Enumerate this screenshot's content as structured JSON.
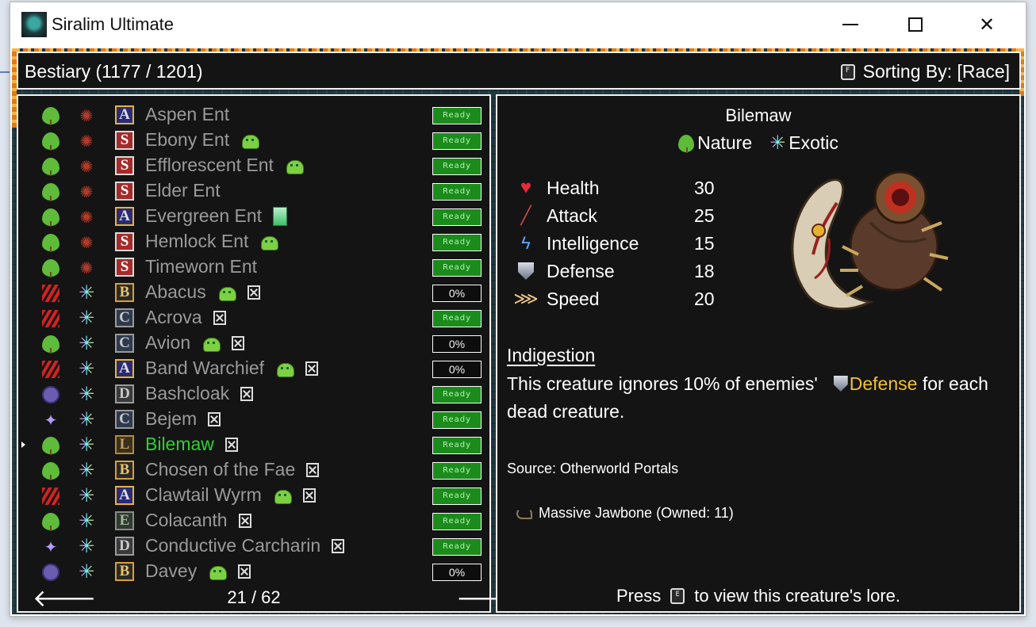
{
  "window": {
    "title": "Siralim Ultimate"
  },
  "header": {
    "title": "Bestiary (1177 / 1201)",
    "sort_key": "F",
    "sort_label": "Sorting By: [Race]"
  },
  "list": {
    "rows": [
      {
        "race": "nature",
        "klass": "spider",
        "rarity": "A",
        "name": "Aspen Ent",
        "extras": [],
        "status": "Ready"
      },
      {
        "race": "nature",
        "klass": "spider",
        "rarity": "S",
        "name": "Ebony Ent",
        "extras": [
          "slime"
        ],
        "status": "Ready"
      },
      {
        "race": "nature",
        "klass": "spider",
        "rarity": "S",
        "name": "Efflorescent Ent",
        "extras": [
          "slime"
        ],
        "status": "Ready"
      },
      {
        "race": "nature",
        "klass": "spider",
        "rarity": "S",
        "name": "Elder Ent",
        "extras": [],
        "status": "Ready"
      },
      {
        "race": "nature",
        "klass": "spider",
        "rarity": "A",
        "name": "Evergreen Ent",
        "extras": [
          "crystal"
        ],
        "status": "Ready"
      },
      {
        "race": "nature",
        "klass": "spider",
        "rarity": "S",
        "name": "Hemlock Ent",
        "extras": [
          "slime"
        ],
        "status": "Ready"
      },
      {
        "race": "nature",
        "klass": "spider",
        "rarity": "S",
        "name": "Timeworn Ent",
        "extras": [],
        "status": "Ready"
      },
      {
        "race": "claw",
        "klass": "exotic",
        "rarity": "B",
        "name": "Abacus",
        "extras": [
          "slime",
          "x"
        ],
        "status": "0%"
      },
      {
        "race": "claw",
        "klass": "exotic",
        "rarity": "C",
        "name": "Acrova",
        "extras": [
          "x"
        ],
        "status": "Ready"
      },
      {
        "race": "nature",
        "klass": "exotic",
        "rarity": "C",
        "name": "Avion",
        "extras": [
          "slime",
          "x"
        ],
        "status": "0%"
      },
      {
        "race": "claw",
        "klass": "exotic",
        "rarity": "A",
        "name": "Band Warchief",
        "extras": [
          "slime",
          "x"
        ],
        "status": "0%"
      },
      {
        "race": "mask",
        "klass": "exotic",
        "rarity": "D",
        "name": "Bashcloak",
        "extras": [
          "x"
        ],
        "status": "Ready"
      },
      {
        "race": "spark",
        "klass": "exotic",
        "rarity": "C",
        "name": "Bejem",
        "extras": [
          "x"
        ],
        "status": "Ready"
      },
      {
        "race": "nature",
        "klass": "exotic",
        "rarity": "L",
        "name": "Bilemaw",
        "extras": [
          "x"
        ],
        "status": "Ready",
        "selected": true
      },
      {
        "race": "nature",
        "klass": "exotic",
        "rarity": "B",
        "name": "Chosen of the Fae",
        "extras": [
          "x"
        ],
        "status": "Ready"
      },
      {
        "race": "claw",
        "klass": "exotic",
        "rarity": "A",
        "name": "Clawtail Wyrm",
        "extras": [
          "slime",
          "x"
        ],
        "status": "Ready"
      },
      {
        "race": "nature",
        "klass": "exotic",
        "rarity": "E",
        "name": "Colacanth",
        "extras": [
          "x"
        ],
        "status": "Ready"
      },
      {
        "race": "spark",
        "klass": "exotic",
        "rarity": "D",
        "name": "Conductive Carcharin",
        "extras": [
          "x"
        ],
        "status": "Ready"
      },
      {
        "race": "mask",
        "klass": "exotic",
        "rarity": "B",
        "name": "Davey",
        "extras": [
          "slime",
          "x"
        ],
        "status": "0%"
      }
    ],
    "page": "21 / 62"
  },
  "detail": {
    "name": "Bilemaw",
    "types": [
      "Nature",
      "Exotic"
    ],
    "stats": [
      {
        "icon": "heart-icon",
        "label": "Health",
        "value": "30"
      },
      {
        "icon": "sword-icon",
        "label": "Attack",
        "value": "25"
      },
      {
        "icon": "lightning-icon",
        "label": "Intelligence",
        "value": "15"
      },
      {
        "icon": "shield-icon",
        "label": "Defense",
        "value": "18"
      },
      {
        "icon": "wing-icon",
        "label": "Speed",
        "value": "20"
      }
    ],
    "ability_title": "Indigestion",
    "ability_desc_pre": "This creature ignores 10% of enemies'",
    "ability_desc_hl": "Defense",
    "ability_desc_post": "for each dead creature.",
    "source": "Source: Otherworld Portals",
    "material": "Massive Jawbone (Owned: 11)",
    "lore_pre": "Press",
    "lore_key": "E",
    "lore_post": "to view this creature's lore."
  },
  "colors": {
    "selected": "#2ed12e",
    "highlight": "#f2c230",
    "ready_bg": "#1b8c1b"
  }
}
